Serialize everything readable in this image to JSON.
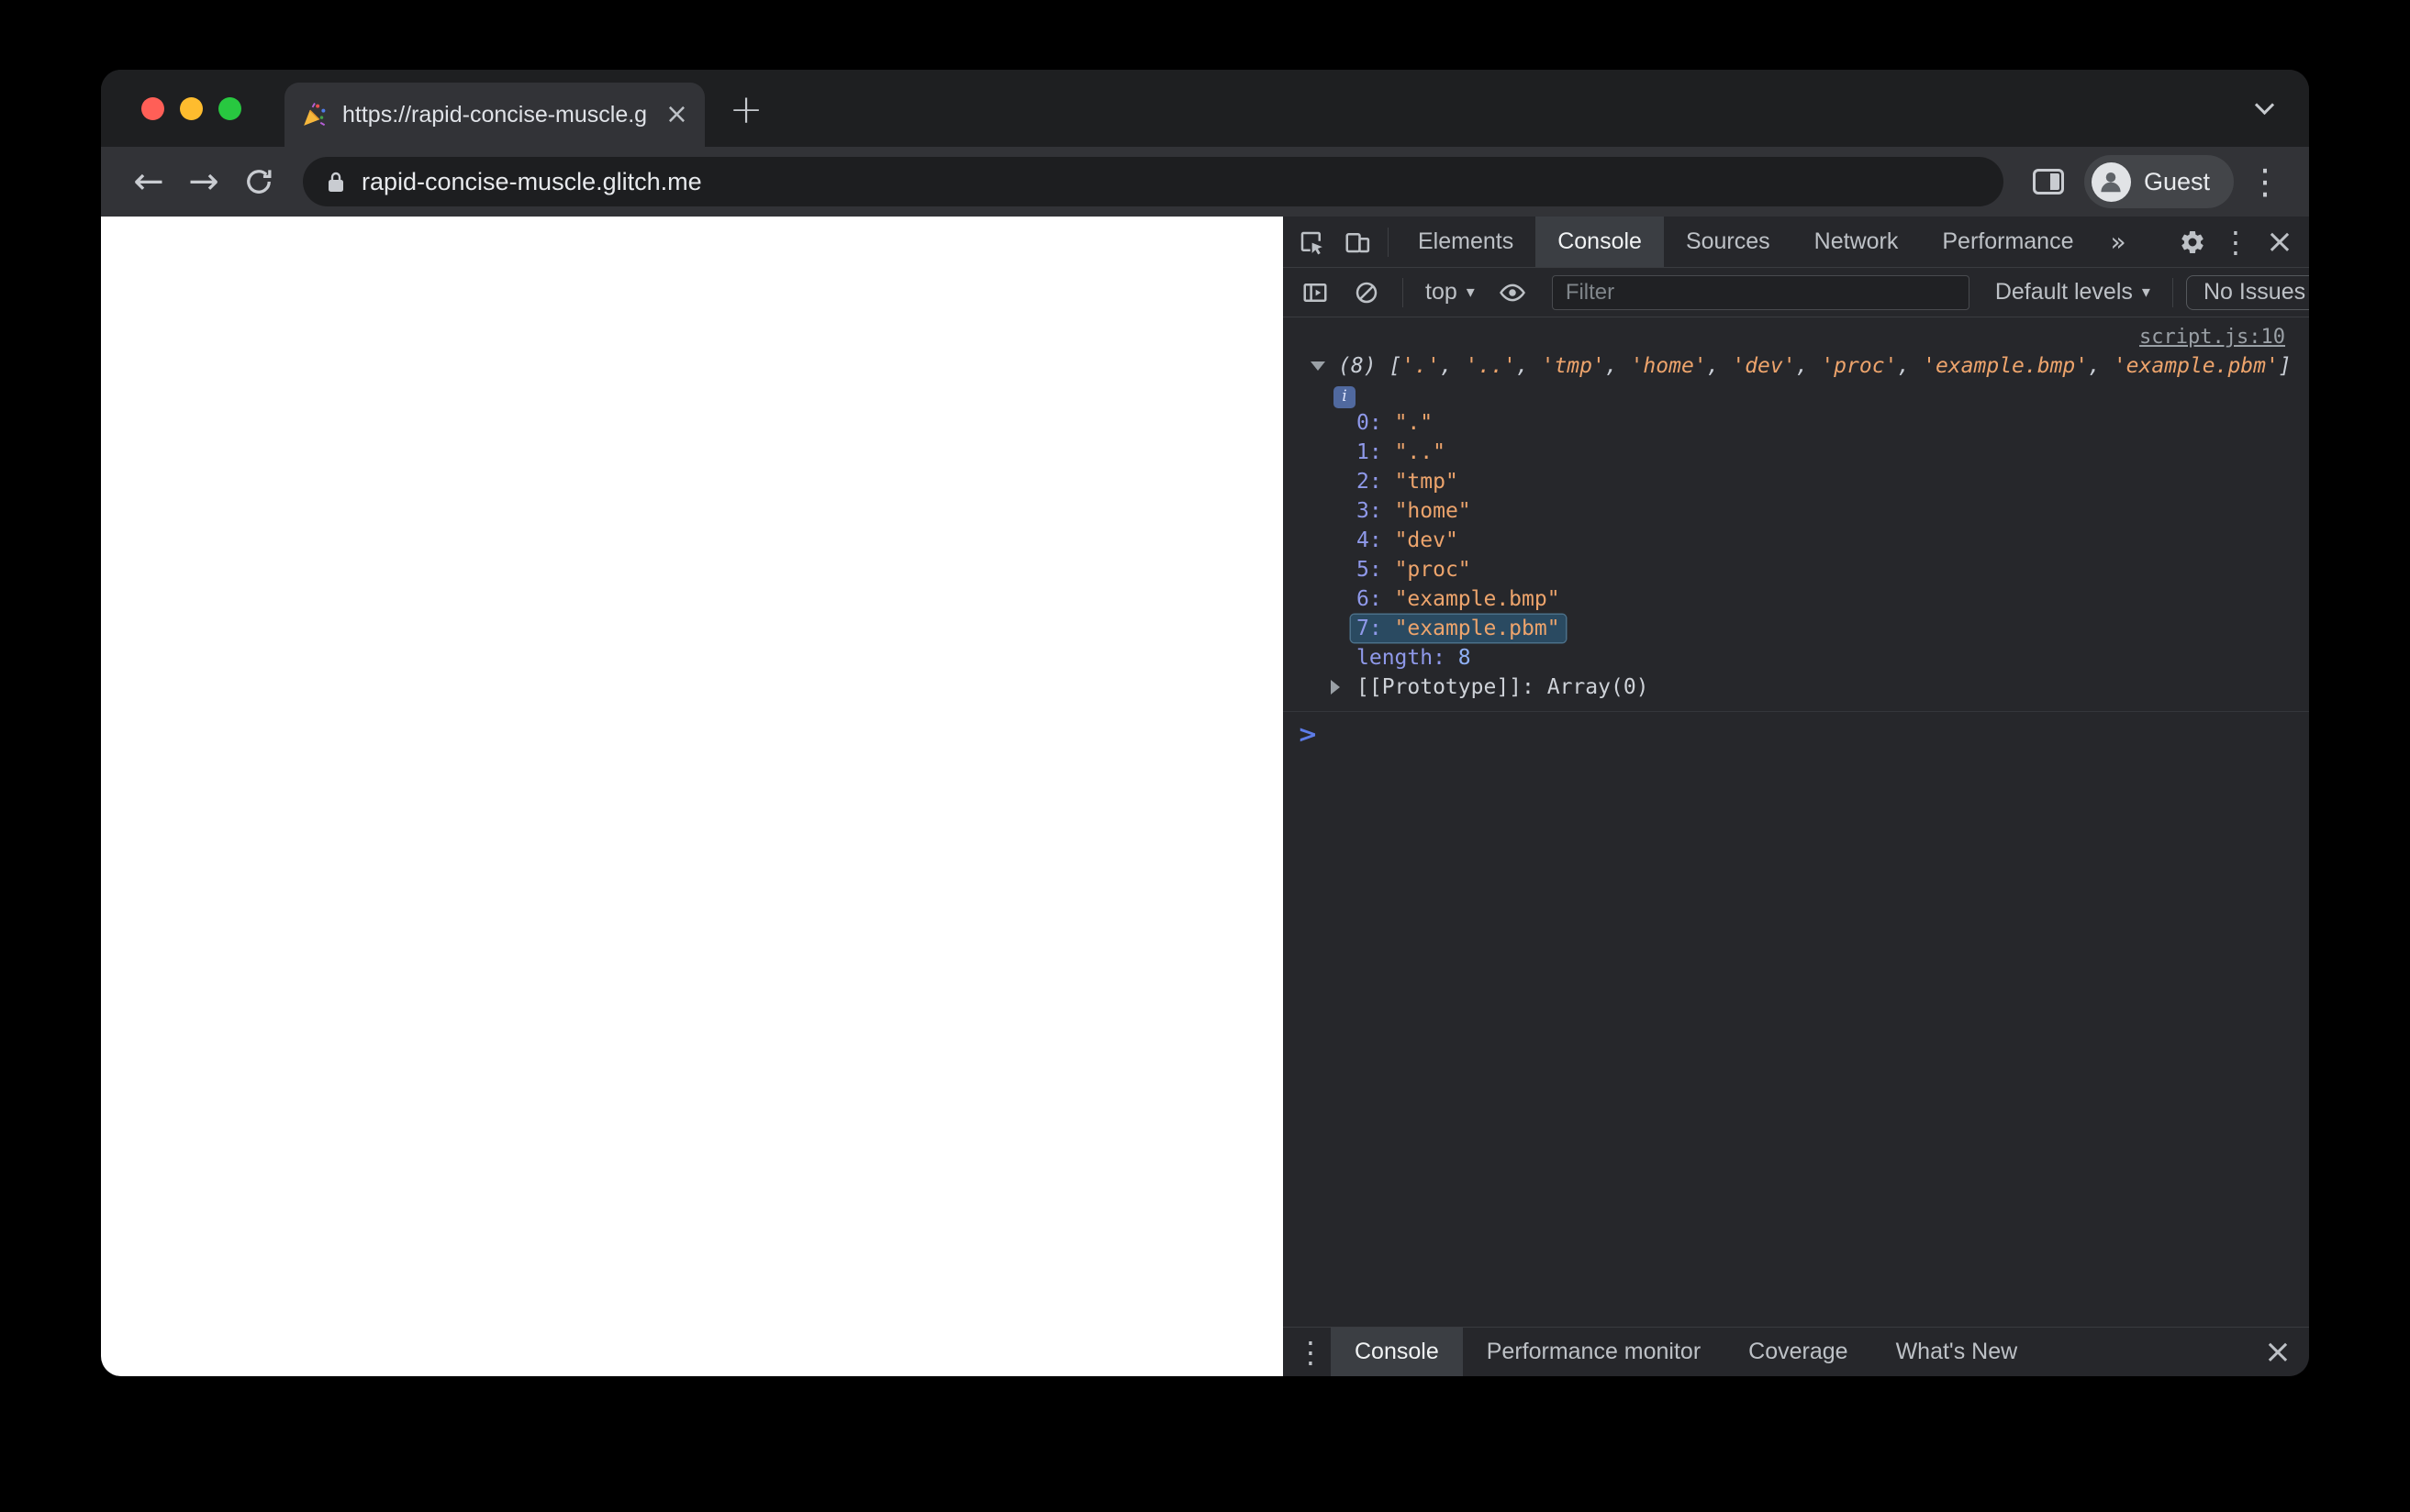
{
  "browser": {
    "tab": {
      "title": "https://rapid-concise-muscle.g"
    },
    "url": "rapid-concise-muscle.glitch.me",
    "profile": "Guest"
  },
  "icons": {
    "back": "←",
    "forward": "→",
    "plus": "+",
    "close": "×",
    "kebab": "⋮",
    "caret": "▾",
    "overflow": "»",
    "prompt": ">",
    "info": "i"
  },
  "devtools": {
    "main_tabs": [
      "Elements",
      "Console",
      "Sources",
      "Network",
      "Performance"
    ],
    "active_main_tab": "Console",
    "filter": {
      "context": "top",
      "placeholder": "Filter",
      "levels": "Default levels",
      "issues": "No Issues"
    },
    "console": {
      "source_link": "script.js:10",
      "count": "(8)",
      "open_bracket": "[",
      "close_bracket": "]",
      "comma": ", ",
      "preview_items": [
        "'.'",
        "'..'",
        "'tmp'",
        "'home'",
        "'dev'",
        "'proc'",
        "'example.bmp'",
        "'example.pbm'"
      ],
      "entries": [
        {
          "key": "0:",
          "value": "\".\""
        },
        {
          "key": "1:",
          "value": "\"..\""
        },
        {
          "key": "2:",
          "value": "\"tmp\""
        },
        {
          "key": "3:",
          "value": "\"home\""
        },
        {
          "key": "4:",
          "value": "\"dev\""
        },
        {
          "key": "5:",
          "value": "\"proc\""
        },
        {
          "key": "6:",
          "value": "\"example.bmp\""
        },
        {
          "key": "7:",
          "value": "\"example.pbm\""
        }
      ],
      "length_key": "length:",
      "length_value": "8",
      "prototype_key": "[[Prototype]]:",
      "prototype_value": "Array(0)"
    },
    "drawer_tabs": [
      "Console",
      "Performance monitor",
      "Coverage",
      "What's New"
    ],
    "active_drawer_tab": "Console"
  },
  "colors": {
    "string": "#eda46c",
    "property": "#8f99ea",
    "number": "#8fb0f6",
    "link": "#9aa0a6",
    "highlight_bg": "#2a4a61",
    "prompt_accent": "#5d7ce8",
    "traffic_red": "#ff5f57",
    "traffic_yellow": "#febc2e",
    "traffic_green": "#28c840"
  }
}
